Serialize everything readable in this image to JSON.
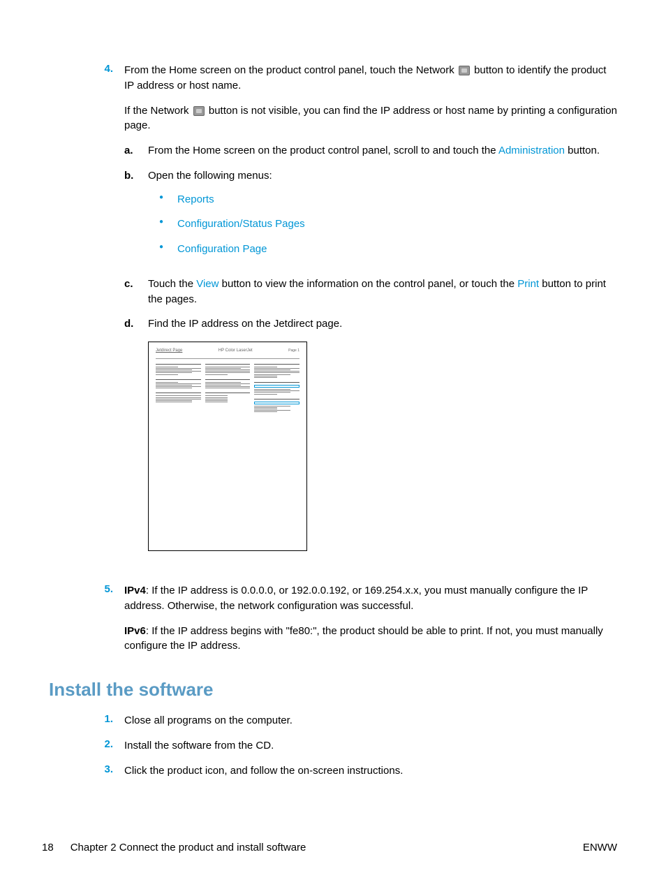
{
  "step4": {
    "num": "4.",
    "p1a": "From the Home screen on the product control panel, touch the Network ",
    "p1b": " button to identify the product IP address or host name.",
    "p2a": "If the Network ",
    "p2b": " button is not visible, you can find the IP address or host name by printing a configuration page.",
    "sub_a": {
      "num": "a.",
      "t1": "From the Home screen on the product control panel, scroll to and touch the ",
      "link": "Administration",
      "t2": " button."
    },
    "sub_b": {
      "num": "b.",
      "text": "Open the following menus:"
    },
    "bullets": [
      "Reports",
      "Configuration/Status Pages",
      "Configuration Page"
    ],
    "sub_c": {
      "num": "c.",
      "t1": "Touch the ",
      "link1": "View",
      "t2": " button to view the information on the control panel, or touch the ",
      "link2": "Print",
      "t3": " button to print the pages."
    },
    "sub_d": {
      "num": "d.",
      "text": "Find the IP address on the Jetdirect page."
    }
  },
  "jetdirect": {
    "title": "Jetdirect Page",
    "mid": "HP Color LaserJet",
    "page": "Page 1"
  },
  "step5": {
    "num": "5.",
    "ipv4_label": "IPv4",
    "ipv4_text": ": If the IP address is 0.0.0.0, or 192.0.0.192, or 169.254.x.x, you must manually configure the IP address. Otherwise, the network configuration was successful.",
    "ipv6_label": "IPv6",
    "ipv6_text": ": If the IP address begins with \"fe80:\", the product should be able to print. If not, you must manually configure the IP address."
  },
  "section": "Install the software",
  "install": [
    {
      "num": "1.",
      "text": "Close all programs on the computer."
    },
    {
      "num": "2.",
      "text": "Install the software from the CD."
    },
    {
      "num": "3.",
      "text": "Click the product icon, and follow the on-screen instructions."
    }
  ],
  "footer": {
    "page": "18",
    "chapter": "Chapter 2   Connect the product and install software",
    "right": "ENWW"
  }
}
